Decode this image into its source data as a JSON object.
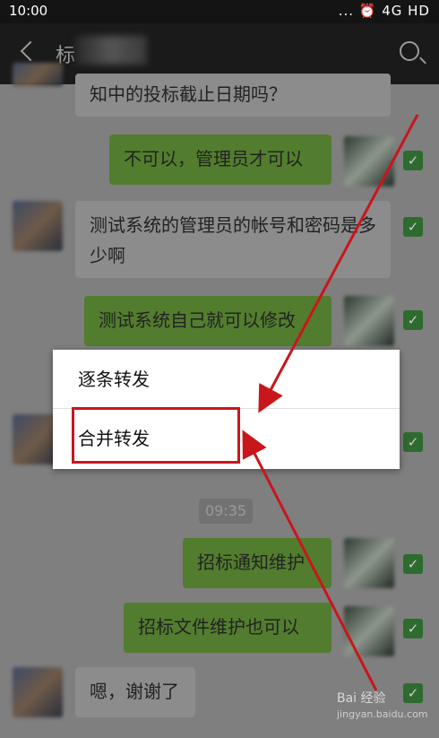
{
  "status_bar": {
    "time": "10:00",
    "indicators": "... ⏰ 4G HD"
  },
  "header": {
    "title": "标"
  },
  "messages": [
    {
      "side": "in",
      "text": "知中的投标截止日期吗？"
    },
    {
      "side": "out",
      "text": "不可以，管理员才可以"
    },
    {
      "side": "in",
      "text": "测试系统的管理员的帐号和密码是多少啊"
    },
    {
      "side": "out",
      "text": "测试系统自己就可以修改"
    },
    {
      "side": "out",
      "text": "招标通知维护"
    },
    {
      "side": "out",
      "text": "招标文件维护也可以"
    },
    {
      "side": "in",
      "text": "嗯，谢谢了"
    }
  ],
  "time_chip": "09:35",
  "context_menu": {
    "items": [
      "逐条转发",
      "合并转发"
    ]
  },
  "checkbox_mark": "✓",
  "watermark": {
    "brand": "Bai 经验",
    "url": "jingyan.baidu.com"
  },
  "colors": {
    "accent_red": "#c8161d",
    "check_green": "#2e6b2e",
    "bubble_out": "#527d2e"
  }
}
